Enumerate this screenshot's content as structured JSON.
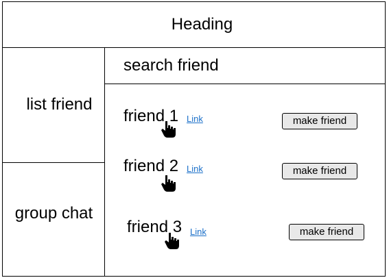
{
  "header": {
    "title": "Heading"
  },
  "sidebar": {
    "items": [
      {
        "label": "list friend"
      },
      {
        "label": "group chat"
      }
    ]
  },
  "search": {
    "label": "search friend"
  },
  "friends": [
    {
      "name": "friend 1",
      "link": "Link",
      "button": "make friend",
      "cursor_icon": "hand-pointer-icon"
    },
    {
      "name": "friend 2",
      "link": "Link",
      "button": "make friend",
      "cursor_icon": "hand-pointer-icon"
    },
    {
      "name": "friend 3",
      "link": "Link",
      "button": "make friend",
      "cursor_icon": "hand-pointer-icon"
    }
  ],
  "colors": {
    "border": "#000000",
    "link": "#1a6fc9",
    "button_bg": "#e8e8e8",
    "background": "#ffffff"
  }
}
